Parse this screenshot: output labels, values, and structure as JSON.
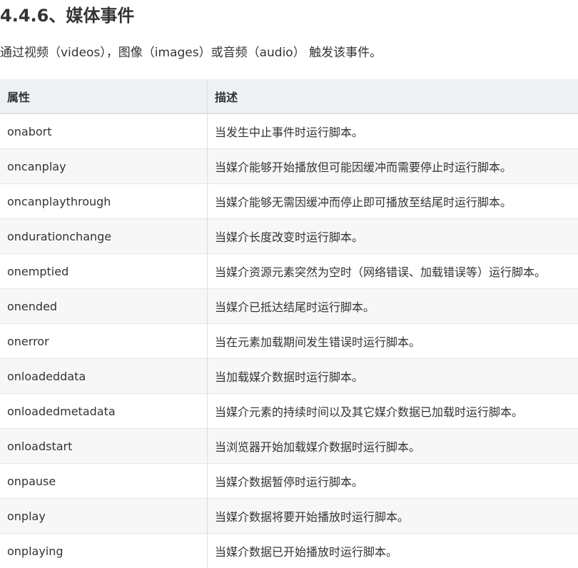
{
  "section": {
    "heading": "4.4.6、媒体事件",
    "intro": "通过视频（videos），图像（images）或音频（audio） 触发该事件。"
  },
  "table": {
    "headers": [
      "属性",
      "描述"
    ],
    "rows": [
      {
        "attr": "onabort",
        "desc": "当发生中止事件时运行脚本。"
      },
      {
        "attr": "oncanplay",
        "desc": "当媒介能够开始播放但可能因缓冲而需要停止时运行脚本。"
      },
      {
        "attr": "oncanplaythrough",
        "desc": "当媒介能够无需因缓冲而停止即可播放至结尾时运行脚本。"
      },
      {
        "attr": "ondurationchange",
        "desc": "当媒介长度改变时运行脚本。"
      },
      {
        "attr": "onemptied",
        "desc": "当媒介资源元素突然为空时（网络错误、加载错误等）运行脚本。"
      },
      {
        "attr": "onended",
        "desc": "当媒介已抵达结尾时运行脚本。"
      },
      {
        "attr": "onerror",
        "desc": "当在元素加载期间发生错误时运行脚本。"
      },
      {
        "attr": "onloadeddata",
        "desc": "当加载媒介数据时运行脚本。"
      },
      {
        "attr": "onloadedmetadata",
        "desc": "当媒介元素的持续时间以及其它媒介数据已加载时运行脚本。"
      },
      {
        "attr": "onloadstart",
        "desc": "当浏览器开始加载媒介数据时运行脚本。"
      },
      {
        "attr": "onpause",
        "desc": "当媒介数据暂停时运行脚本。"
      },
      {
        "attr": "onplay",
        "desc": "当媒介数据将要开始播放时运行脚本。"
      },
      {
        "attr": "onplaying",
        "desc": "当媒介数据已开始播放时运行脚本。"
      }
    ]
  }
}
